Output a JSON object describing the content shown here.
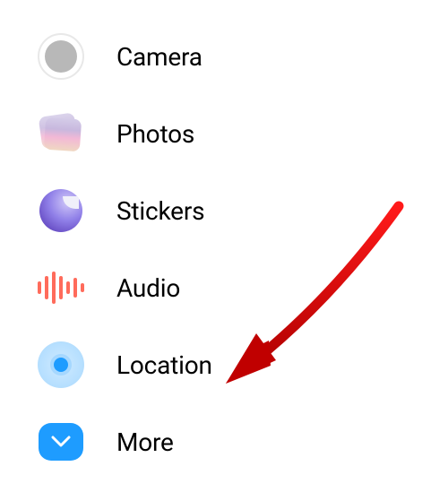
{
  "attachment_menu": {
    "items": [
      {
        "label": "Camera",
        "icon": "camera"
      },
      {
        "label": "Photos",
        "icon": "photos"
      },
      {
        "label": "Stickers",
        "icon": "stickers"
      },
      {
        "label": "Audio",
        "icon": "audio"
      },
      {
        "label": "Location",
        "icon": "location"
      },
      {
        "label": "More",
        "icon": "more-chevron"
      }
    ]
  },
  "annotation": {
    "type": "arrow",
    "target": "location-item",
    "color": "#d40000"
  }
}
